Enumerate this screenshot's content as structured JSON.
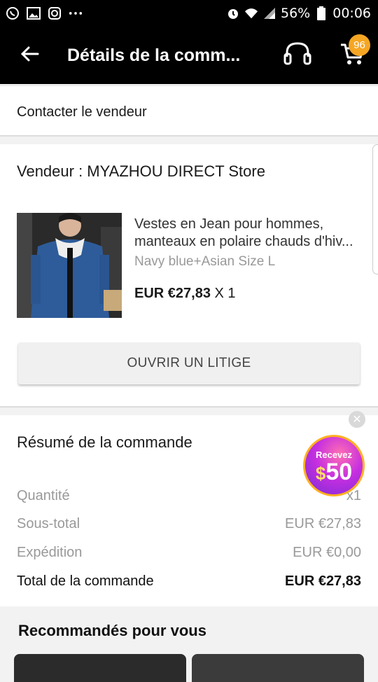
{
  "status_bar": {
    "battery": "56%",
    "time": "00:06",
    "left_icons": [
      "whatsapp-icon",
      "gallery-icon",
      "instagram-icon",
      "more-dots-icon"
    ],
    "right_icons": [
      "alarm-icon",
      "wifi-icon",
      "signal-icon",
      "battery-icon"
    ]
  },
  "app_bar": {
    "title": "Détails de la comm...",
    "cart_badge": "96",
    "icons": [
      "back-arrow-icon",
      "headset-icon",
      "cart-icon"
    ]
  },
  "contact": {
    "label": "Contacter le vendeur"
  },
  "seller": {
    "name": "Vendeur : MYAZHOU DIRECT Store",
    "product": {
      "title_line1": "Vestes en Jean pour hommes,",
      "title_line2": "manteaux en polaire chauds d'hiv...",
      "variant": "Navy blue+Asian Size L",
      "price": "EUR €27,83",
      "qty": "X 1"
    },
    "dispute_button": "OUVRIR UN LITIGE"
  },
  "summary": {
    "title": "Résumé de la commande",
    "rows": [
      {
        "label": "Quantité",
        "value": "x1"
      },
      {
        "label": "Sous-total",
        "value": "EUR €27,83"
      },
      {
        "label": "Expédition",
        "value": "EUR €0,00"
      },
      {
        "label": "Total de la commande",
        "value": "EUR €27,83"
      }
    ],
    "coupon": {
      "top": "Recevez",
      "currency": "$",
      "amount": "50"
    }
  },
  "recommendations": {
    "title": "Recommandés pour vous"
  },
  "colors": {
    "badge": "#f5a623",
    "app_bar": "#000000",
    "muted_text": "#999999"
  }
}
